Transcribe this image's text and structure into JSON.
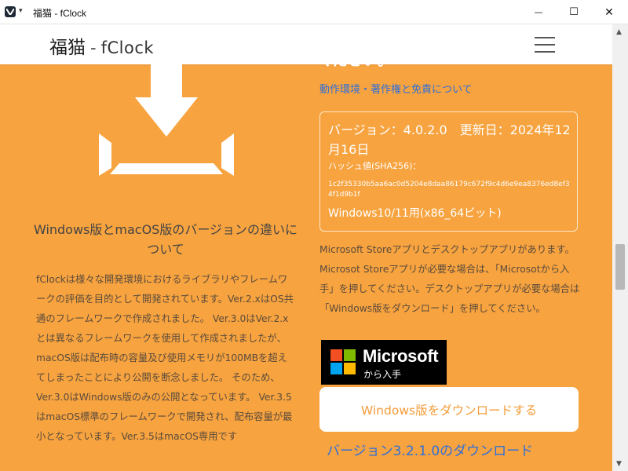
{
  "window": {
    "title": "福猫 - fClock",
    "caret": "▾",
    "minimize": "—",
    "maximize": "☐",
    "close": "✕"
  },
  "header": {
    "brand_main": "福猫",
    "brand_dash": "-",
    "brand_app": "fClock"
  },
  "left": {
    "heading": "Windows版とmacOS版のバージョンの違いについて",
    "body": "fClockは様々な開発環境におけるライブラリやフレームワークの評価を目的として開発されています。Ver.2.xはOS共通のフレームワークで作成されました。 Ver.3.0はVer.2.xとは異なるフレームワークを使用して作成されましたが、macOS版は配布時の容量及び使用メモリが100MBを超えてしまったことにより公開を断念しました。 そのため、Ver.3.0はWindows版のみの公開となっています。 Ver.3.5はmacOS標準のフレームワークで開発され、配布容量が最小となっています。Ver.3.5はmacOS専用です"
  },
  "right": {
    "cut_heading": "ください。",
    "top_link": "動作環境・著作権と免責について",
    "version_line": "バージョン：4.0.2.0　更新日：2024年12月16日",
    "hash_label": "ハッシュ値(SHA256)：",
    "hash_value": "1c2f35330b5aa6ac0d5204e8daa86179c672f9c4d6e9ea8376ed8ef34f1d9b1f",
    "platform": "Windows10/11用(x86_64ビット)",
    "store_desc": "Microsoft Storeアプリとデスクトップアプリがあります。Microsot Storeアプリが必要な場合は、「Microsotから入手」を押してください。デスクトップアプリが必要な場合は「Windows版をダウンロード」を押してください。",
    "ms_badge_name": "Microsoft",
    "ms_badge_sub": "から入手",
    "download_button": "Windows版をダウンロードする",
    "bottom_link": "バージョン3.2.1.0のダウンロード"
  },
  "colors": {
    "background": "#f7a33f",
    "link": "#2f6fd8",
    "button_text": "#f39c38",
    "ms_red": "#f25022",
    "ms_green": "#7fba00",
    "ms_blue": "#00a4ef",
    "ms_yellow": "#ffb900"
  },
  "icons": {
    "app": "vivaldi-icon",
    "download": "download-tray-icon",
    "menu": "hamburger-menu-icon",
    "microsoft": "microsoft-logo-icon"
  }
}
